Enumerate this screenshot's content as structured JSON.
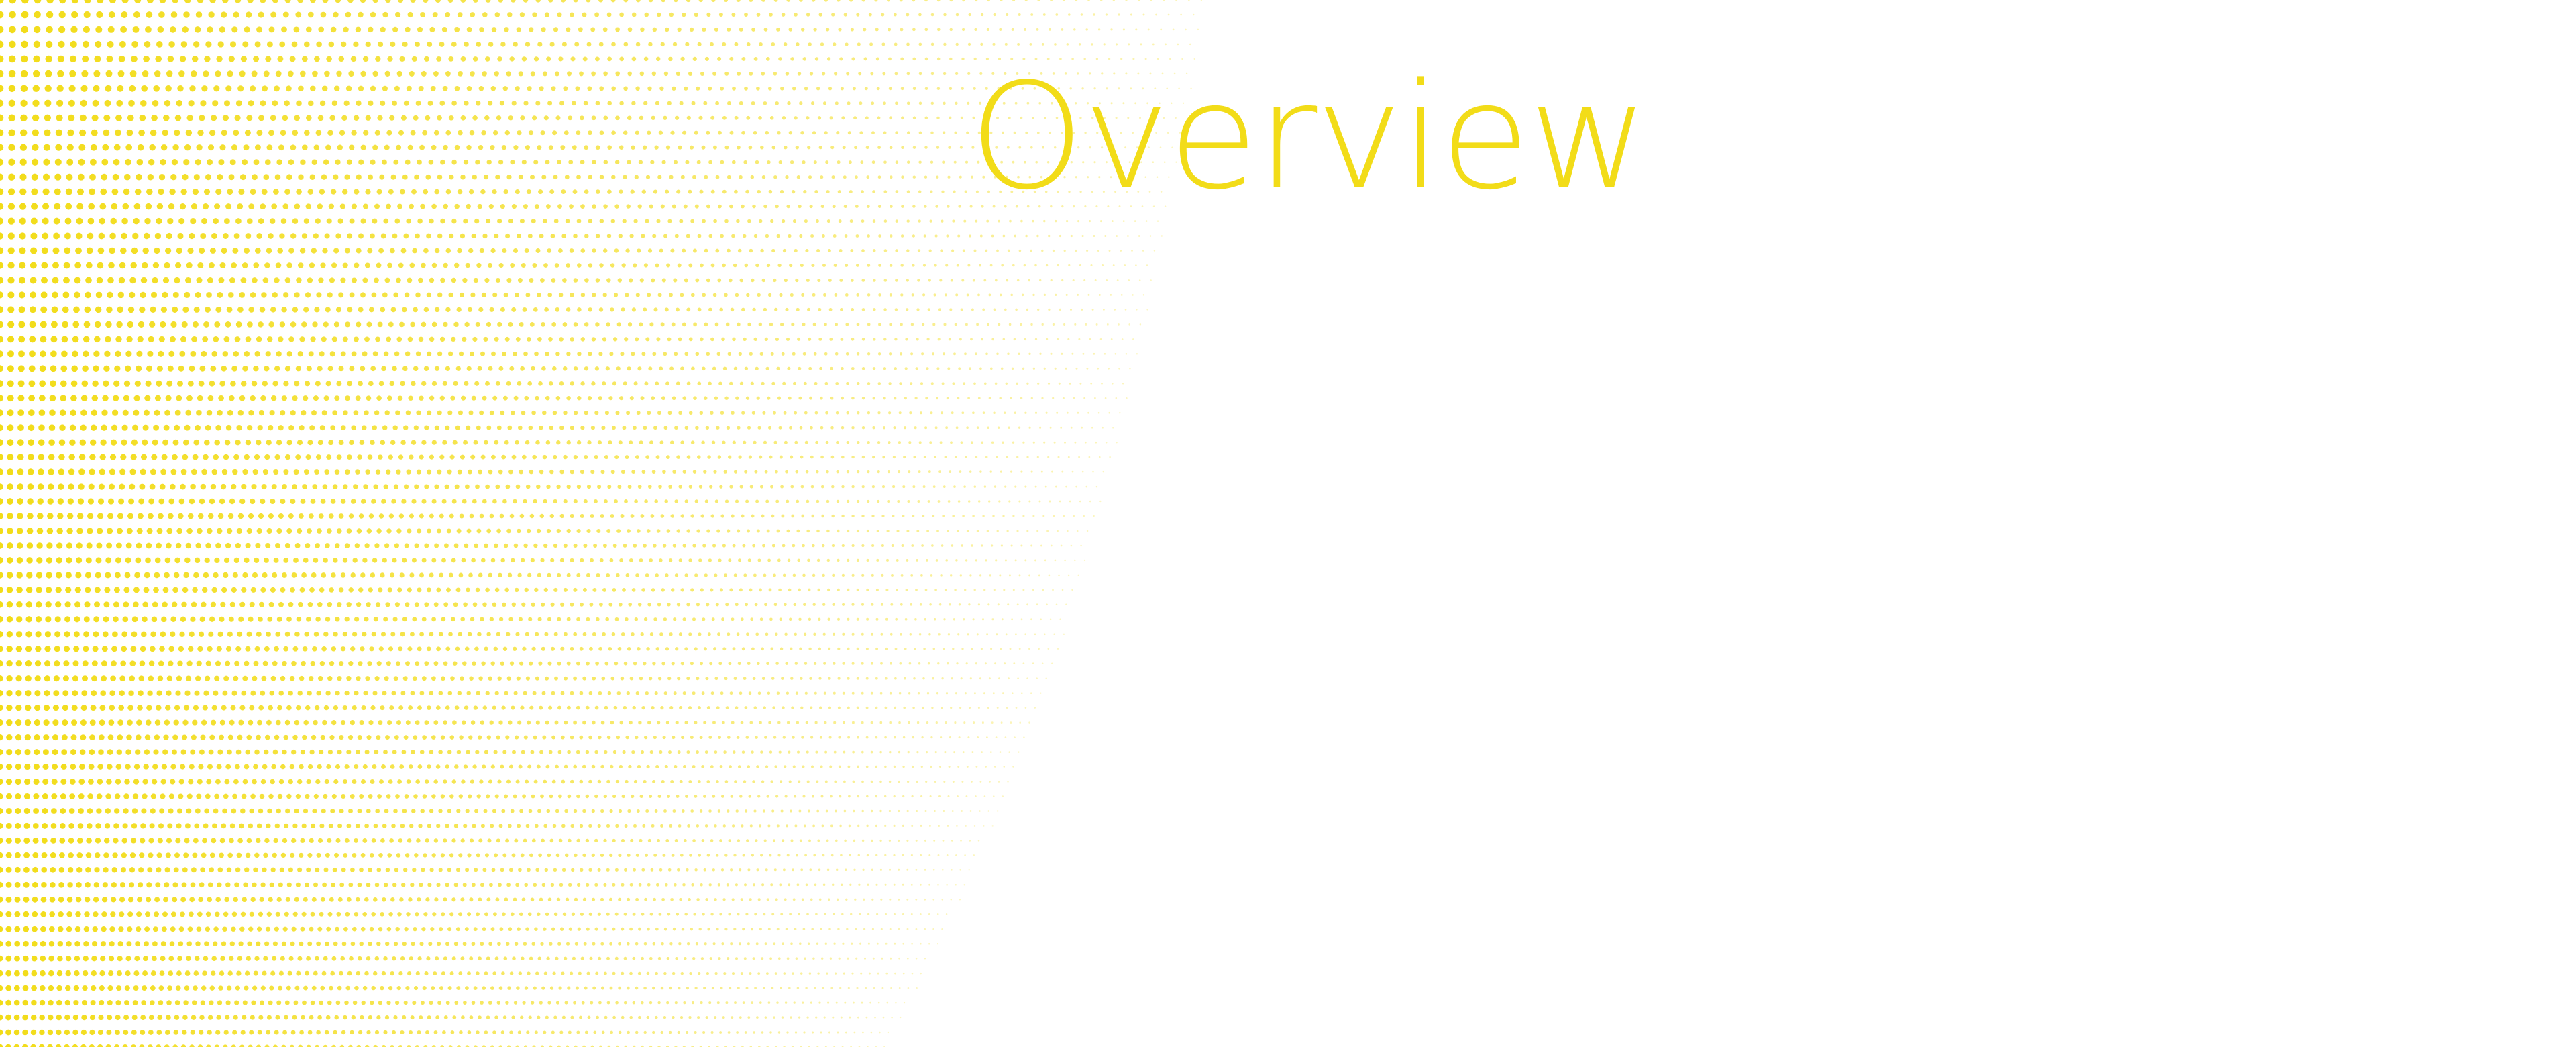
{
  "page": {
    "title": "Overview"
  },
  "theme": {
    "accent_color": "#F2DC18",
    "background_color": "#FFFFFF"
  },
  "decoration": {
    "pattern": "halftone-dot-swoosh"
  }
}
